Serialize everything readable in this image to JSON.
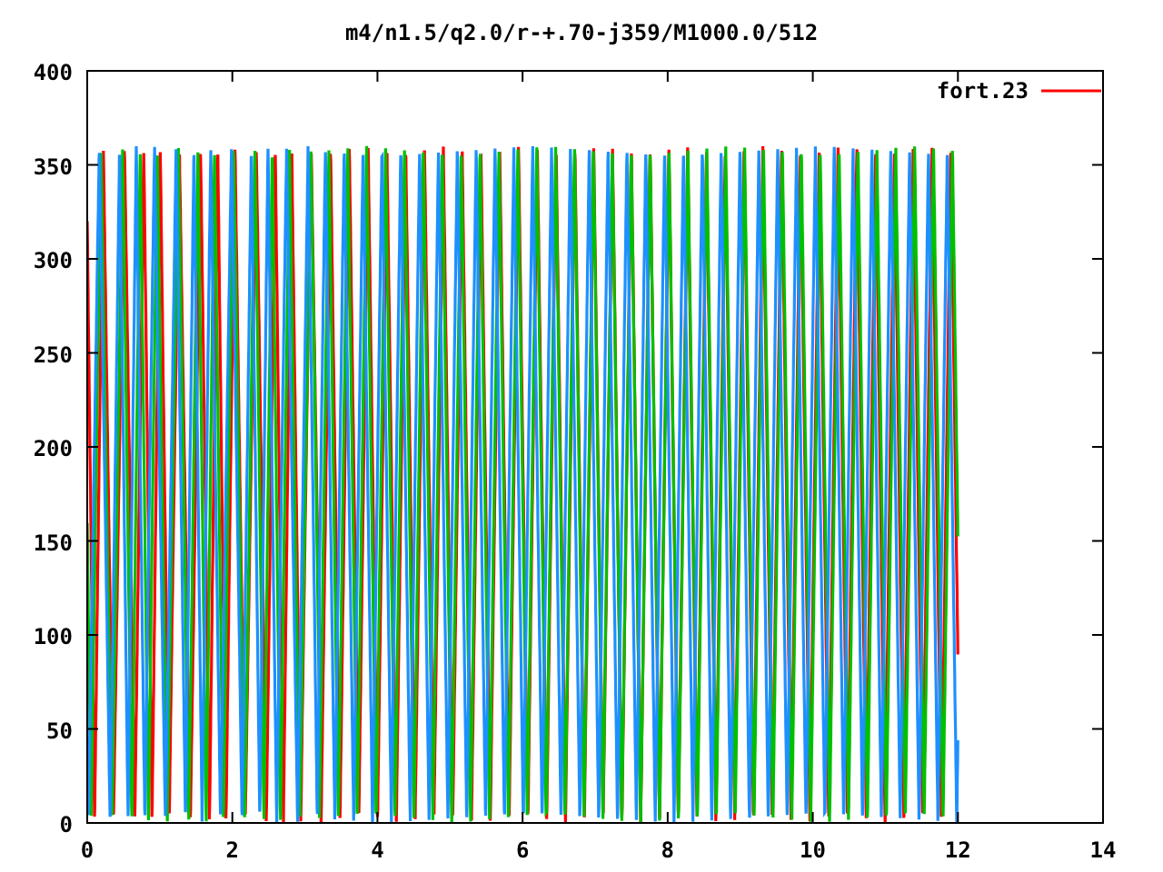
{
  "plot": {
    "title": "m4/n1.5/q2.0/r-+.70-j359/M1000.0/512",
    "legend": [
      {
        "label": "fort.23"
      }
    ],
    "xticks": [
      "0",
      "2",
      "4",
      "6",
      "8",
      "10",
      "12",
      "14"
    ],
    "yticks": [
      "400",
      "350",
      "300",
      "250",
      "200",
      "150",
      "100",
      "50",
      "0"
    ]
  }
}
